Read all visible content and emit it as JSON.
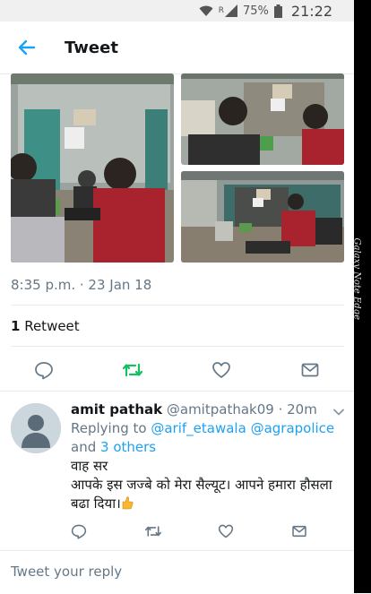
{
  "status_bar": {
    "battery": "75%",
    "time": "21:22",
    "network": "R"
  },
  "side_label": "Galaxy Note Edge",
  "header": {
    "title": "Tweet"
  },
  "tweet": {
    "timestamp": "8:35 p.m. · 23 Jan 18",
    "retweet_count": "1",
    "retweet_label": " Retweet"
  },
  "reply": {
    "name": "amit pathak",
    "handle": "@amitpathak09",
    "time": "· 20m",
    "replying_prefix": "Replying to ",
    "replying_user1": "@arif_etawala",
    "replying_user2": "@agrapolice",
    "replying_and": " and",
    "replying_others": "3 others",
    "line1": "वाह सर",
    "line2": "आपके इस जज्बे को मेरा सैल्यूट। आपने हमारा हौसला बढा दिया।"
  },
  "compose": {
    "placeholder": "Tweet your reply"
  },
  "colors": {
    "accent": "#1da1f2",
    "retweet_green": "#17bf63",
    "muted": "#657786"
  }
}
